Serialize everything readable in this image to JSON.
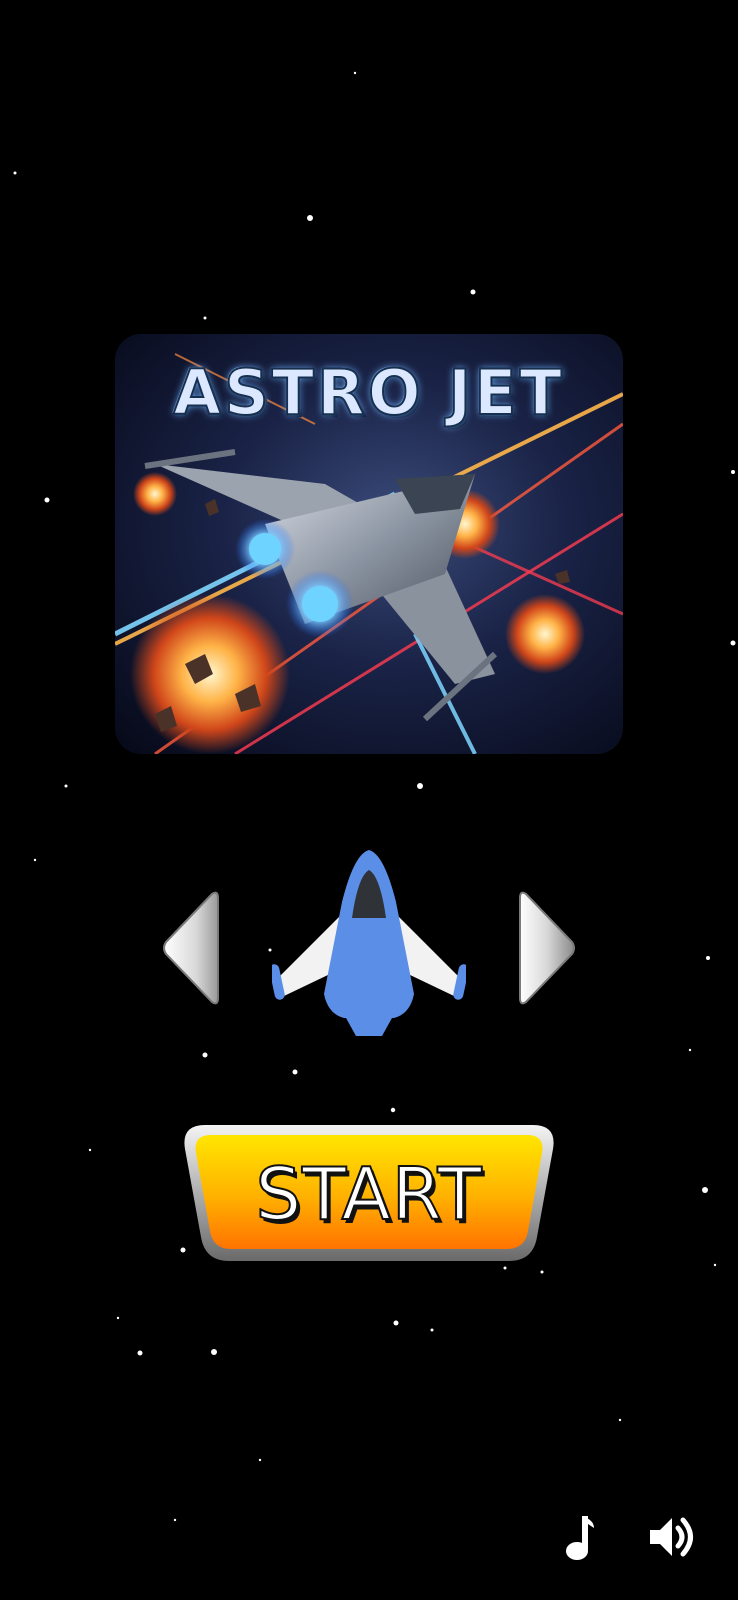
{
  "game": {
    "title": "ASTRO JET",
    "start_label": "START"
  },
  "controls": {
    "prev_ship": "arrow-left-icon",
    "next_ship": "arrow-right-icon",
    "music": "music-note-icon",
    "sound": "speaker-volume-icon"
  },
  "colors": {
    "background": "#000000",
    "start_top": "#ffe200",
    "start_bottom": "#ff7a00",
    "ship_blue": "#5b8ee6",
    "ship_wing": "#f2f2f2"
  }
}
